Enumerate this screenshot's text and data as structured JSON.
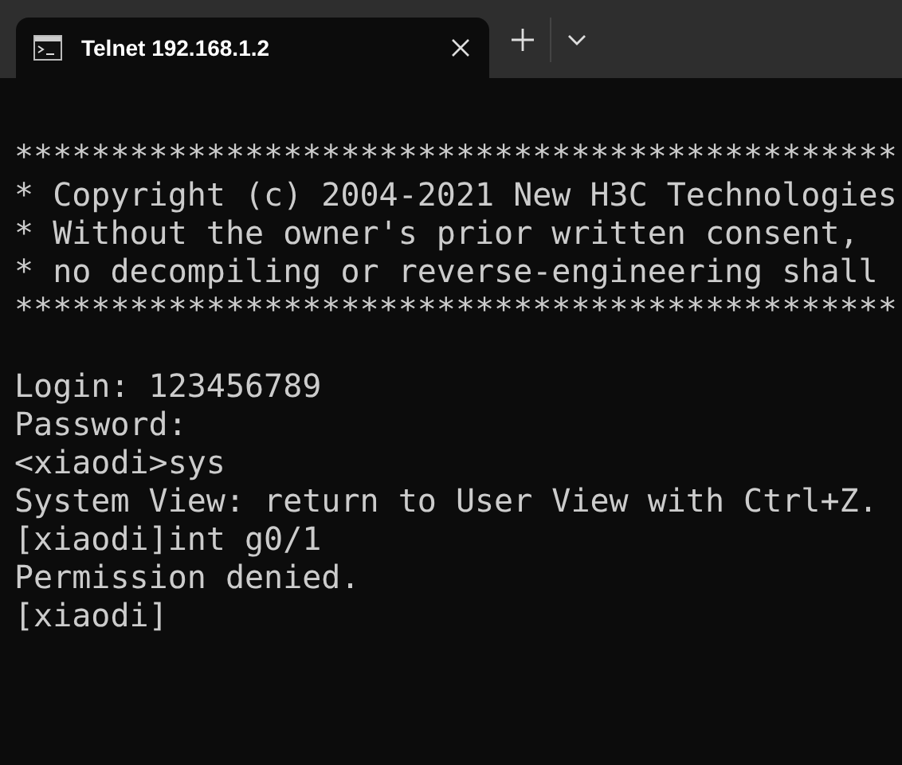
{
  "tabs": [
    {
      "title": "Telnet 192.168.1.2",
      "selected": true
    }
  ],
  "terminal": {
    "blocks": [
      {
        "lines": [
          "**********************************************",
          "* Copyright (c) 2004-2021 New H3C Technologies",
          "* Without the owner's prior written consent,",
          "* no decompiling or reverse-engineering shall",
          "**********************************************"
        ]
      },
      {
        "lines": [
          "Login: 123456789",
          "Password:",
          "<xiaodi>sys",
          "System View: return to User View with Ctrl+Z.",
          "[xiaodi]int g0/1",
          "Permission denied.",
          "[xiaodi]"
        ]
      }
    ]
  }
}
